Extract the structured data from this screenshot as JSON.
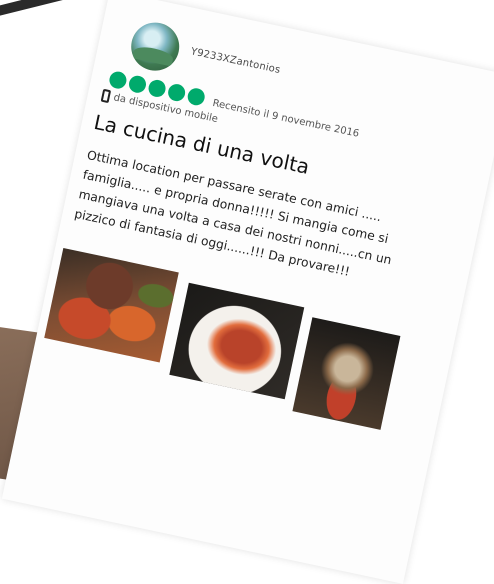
{
  "review": {
    "username": "Y9233XZantonios",
    "rating_bubbles": 5,
    "rating_color": "#00aa6c",
    "date": "Recensito il 9 novembre 2016",
    "device_icon": "mobile-phone-icon",
    "device_text": "da dispositivo mobile",
    "title": "La cucina di una volta",
    "body_lines": [
      "Ottima location per passare serate con amici .....",
      "famiglia..... e propria donna!!!!! Si mangia come si",
      "mangiava una volta a casa dei nostri nonni.....cn un",
      "pizzico di fantasia di oggi......!!! Da provare!!!"
    ],
    "photos": [
      "food-photo-1",
      "food-photo-2",
      "food-photo-3"
    ]
  }
}
